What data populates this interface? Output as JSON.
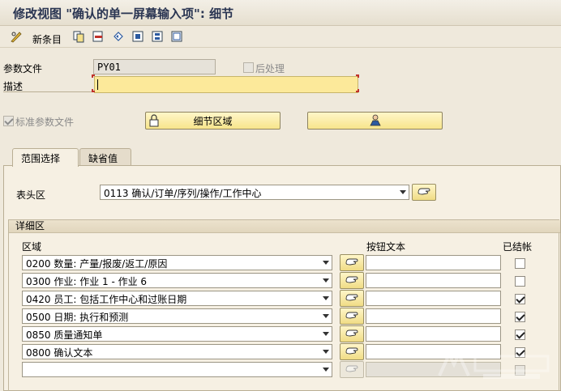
{
  "window": {
    "title": "修改视图 \"确认的单一屏幕输入项\": 细节"
  },
  "toolbar": {
    "new_entries_label": "新条目",
    "icons": [
      "pencil-glasses-icon",
      "copy-icon",
      "delete-icon",
      "undo-icon",
      "select-all-icon",
      "select-block-icon",
      "deselect-icon"
    ]
  },
  "header": {
    "profile_label": "参数文件",
    "profile_value": "PY01",
    "post_processing_label": "后处理",
    "description_label": "描述",
    "description_value": "",
    "std_profile_label": "标准参数文件",
    "detail_area_button": "细节区域"
  },
  "tabs": [
    {
      "label": "范围选择",
      "active": true
    },
    {
      "label": "缺省值",
      "active": false
    }
  ],
  "header_area": {
    "label": "表头区",
    "value": "0113 确认/订单/序列/操作/工作中心"
  },
  "detail_area": {
    "group_title": "详细区",
    "col_area": "区域",
    "col_button_text": "按钮文本",
    "col_collapsed": "已结帐",
    "rows": [
      {
        "area": "0200 数量: 产量/报废/返工/原因",
        "button_text": "",
        "checked": false
      },
      {
        "area": "0300 作业: 作业 1 - 作业 6",
        "button_text": "",
        "checked": false
      },
      {
        "area": "0420 员工: 包括工作中心和过账日期",
        "button_text": "",
        "checked": true
      },
      {
        "area": "0500 日期: 执行和预测",
        "button_text": "",
        "checked": true
      },
      {
        "area": "0850 质量通知单",
        "button_text": "",
        "checked": true
      },
      {
        "area": "0800 确认文本",
        "button_text": "",
        "checked": true
      },
      {
        "area": "",
        "button_text": "",
        "checked": false,
        "disabled": true
      }
    ]
  },
  "colors": {
    "title": "#2a3552",
    "required_field": "#fce99a",
    "button_yellow": "#f7e58b",
    "background": "#efe9dc"
  }
}
